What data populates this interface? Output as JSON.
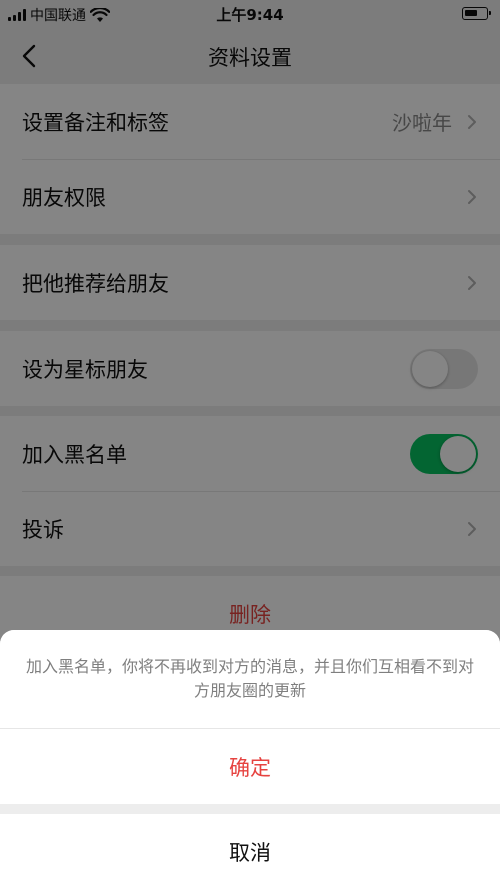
{
  "status_bar": {
    "carrier": "中国联通",
    "time": "上午9:44"
  },
  "nav": {
    "title": "资料设置"
  },
  "settings": {
    "remark_label": "设置备注和标签",
    "remark_value": "沙啦年",
    "permission_label": "朋友权限",
    "recommend_label": "把他推荐给朋友",
    "star_label": "设为星标朋友",
    "star_on": false,
    "blacklist_label": "加入黑名单",
    "blacklist_on": true,
    "report_label": "投诉",
    "delete_label": "删除"
  },
  "colors": {
    "accent_green": "#07c160",
    "danger_red": "#e64340",
    "background": "#ededed"
  },
  "sheet": {
    "message": "加入黑名单，你将不再收到对方的消息，并且你们互相看不到对方朋友圈的更新",
    "confirm_label": "确定",
    "cancel_label": "取消"
  }
}
